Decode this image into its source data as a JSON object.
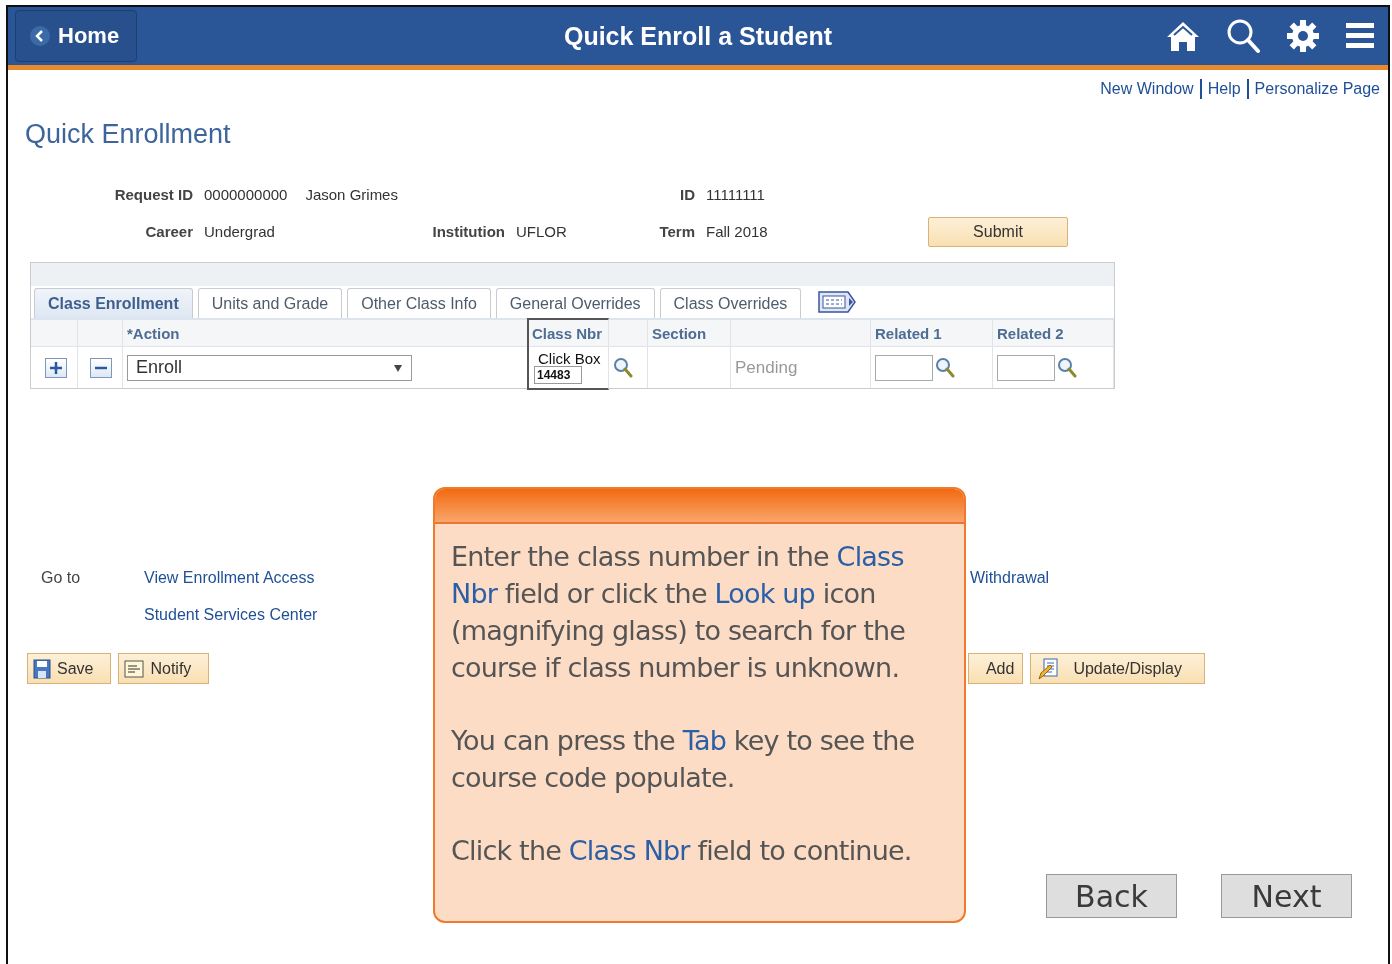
{
  "header": {
    "back_button": "Home",
    "title": "Quick Enroll a Student"
  },
  "top_links": [
    "New Window",
    "Help",
    "Personalize Page"
  ],
  "page_title": "Quick Enrollment",
  "info": {
    "request_id_label": "Request ID",
    "request_id": "0000000000",
    "name": "Jason Grimes",
    "id_label": "ID",
    "id": "11111111",
    "career_label": "Career",
    "career": "Undergrad",
    "institution_label": "Institution",
    "institution": "UFLOR",
    "term_label": "Term",
    "term": "Fall 2018",
    "submit_button": "Submit"
  },
  "tabs": [
    {
      "label": "Class Enrollment",
      "selected": true
    },
    {
      "label": "Units and Grade",
      "selected": false
    },
    {
      "label": "Other Class Info",
      "selected": false
    },
    {
      "label": "General Overrides",
      "selected": false
    },
    {
      "label": "Class Overrides",
      "selected": false
    }
  ],
  "table": {
    "columns": [
      "*Action",
      "Class Nbr",
      "Section",
      "Related 1",
      "Related 2"
    ],
    "rows": [
      {
        "action": "Enroll",
        "class_nbr": "14483",
        "status": "Pending"
      }
    ]
  },
  "click_box_label": "Click Box",
  "goto": {
    "label": "Go to",
    "links": [
      "View Enrollment Access",
      "Student Services Center"
    ],
    "withdrawal_link": "Withdrawal"
  },
  "buttons": [
    {
      "label": "Save",
      "kind": "save"
    },
    {
      "label": "Notify",
      "kind": "notify"
    },
    {
      "label": "Add",
      "kind": "hidden-left"
    },
    {
      "label": "Update/Display",
      "kind": "update"
    }
  ],
  "callout": {
    "paragraphs": [
      "Enter the class number in the **Class Nbr** field or click the **Look up** icon (magnifying glass) to search for the course if class number is unknown.",
      "You can press the **Tab** key to see the course code populate.",
      "Click the **Class Nbr** field to continue."
    ]
  },
  "nav_buttons": [
    "Back",
    "Next"
  ]
}
